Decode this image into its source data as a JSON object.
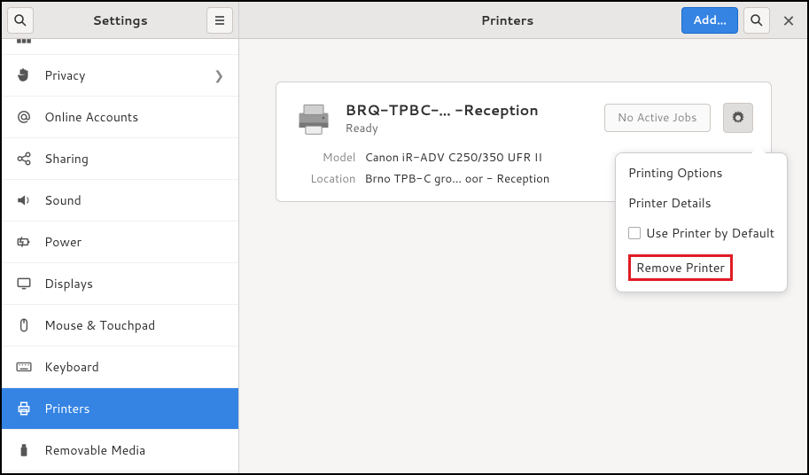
{
  "sidebar": {
    "title": "Settings",
    "items": [
      {
        "label": "Privacy",
        "icon": "hand",
        "chevron": true
      },
      {
        "label": "Online Accounts",
        "icon": "at"
      },
      {
        "label": "Sharing",
        "icon": "share"
      },
      {
        "label": "Sound",
        "icon": "speaker"
      },
      {
        "label": "Power",
        "icon": "power"
      },
      {
        "label": "Displays",
        "icon": "display"
      },
      {
        "label": "Mouse & Touchpad",
        "icon": "mouse"
      },
      {
        "label": "Keyboard",
        "icon": "keyboard"
      },
      {
        "label": "Printers",
        "icon": "printer",
        "active": true
      },
      {
        "label": "Removable Media",
        "icon": "usb"
      }
    ]
  },
  "main": {
    "title": "Printers",
    "add_label": "Add…"
  },
  "printer": {
    "name": "BRQ-TPBC-…  -Reception",
    "status": "Ready",
    "model_label": "Model",
    "model_value": "Canon iR-ADV C250/350 UFR II",
    "location_label": "Location",
    "location_value": "Brno TPB-C gro… oor - Reception",
    "jobs_label": "No Active Jobs"
  },
  "popover": {
    "printing_options": "Printing Options",
    "printer_details": "Printer Details",
    "use_default": "Use Printer by Default",
    "remove": "Remove Printer"
  }
}
